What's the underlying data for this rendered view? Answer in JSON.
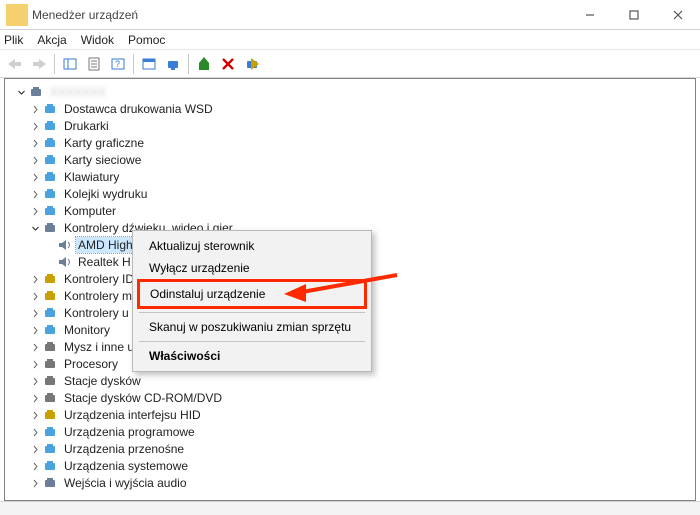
{
  "title": "Menedżer urządzeń",
  "menu": {
    "file": "Plik",
    "action": "Akcja",
    "view": "Widok",
    "help": "Pomoc"
  },
  "tree": {
    "root": "",
    "items": [
      {
        "l": "Dostawca drukowania WSD"
      },
      {
        "l": "Drukarki"
      },
      {
        "l": "Karty graficzne"
      },
      {
        "l": "Karty sieciowe"
      },
      {
        "l": "Klawiatury"
      },
      {
        "l": "Kolejki wydruku"
      },
      {
        "l": "Komputer"
      },
      {
        "l": "Kontrolery dźwięku, wideo i gier",
        "open": true,
        "children": [
          {
            "l": "AMD High Definition Audio Device",
            "sel": true
          },
          {
            "l": "Realtek H"
          }
        ]
      },
      {
        "l": "Kontrolery ID"
      },
      {
        "l": "Kontrolery m"
      },
      {
        "l": "Kontrolery u"
      },
      {
        "l": "Monitory"
      },
      {
        "l": "Mysz i inne u"
      },
      {
        "l": "Procesory"
      },
      {
        "l": "Stacje dysków"
      },
      {
        "l": "Stacje dysków CD-ROM/DVD"
      },
      {
        "l": "Urządzenia interfejsu HID"
      },
      {
        "l": "Urządzenia programowe"
      },
      {
        "l": "Urządzenia przenośne"
      },
      {
        "l": "Urządzenia systemowe"
      },
      {
        "l": "Wejścia i wyjścia audio"
      }
    ]
  },
  "ctx": {
    "update": "Aktualizuj sterownik",
    "disable": "Wyłącz urządzenie",
    "uninstall": "Odinstaluj urządzenie",
    "scan": "Skanuj w poszukiwaniu zmian sprzętu",
    "properties": "Właściwości"
  }
}
